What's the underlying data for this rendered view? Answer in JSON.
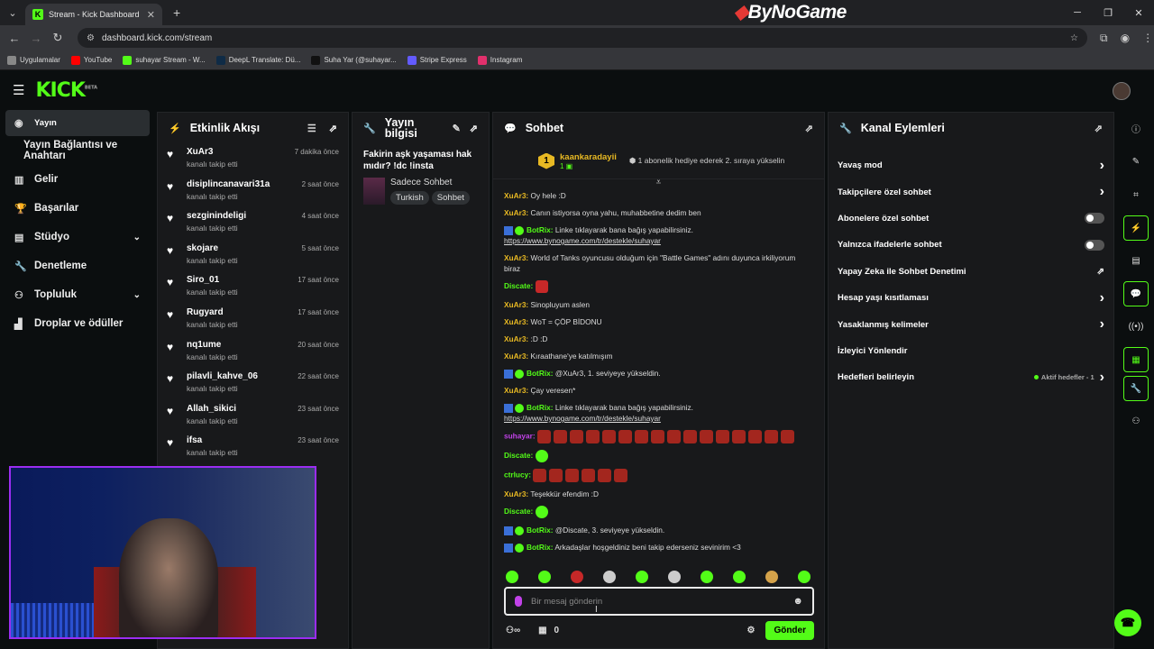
{
  "browser": {
    "tab_title": "Stream - Kick Dashboard",
    "url": "dashboard.kick.com/stream",
    "overlay_brand": "ByNoGame",
    "bookmarks": [
      {
        "label": "Uygulamalar",
        "color": "#888888"
      },
      {
        "label": "YouTube",
        "color": "#ff0000"
      },
      {
        "label": "suhayar Stream - W...",
        "color": "#53fc18"
      },
      {
        "label": "DeepL Translate: Dü...",
        "color": "#0f2b46"
      },
      {
        "label": "Suha Yar (@suhayar...",
        "color": "#111111"
      },
      {
        "label": "Stripe Express",
        "color": "#635bff"
      },
      {
        "label": "Instagram",
        "color": "#e1306c"
      }
    ]
  },
  "kick": {
    "logo": "KICK",
    "logo_sup": "BETA"
  },
  "sidebar": {
    "items": [
      {
        "label": "Yayın",
        "icon": "broadcast-icon"
      },
      {
        "label": "Yayın Bağlantısı ve Anahtarı",
        "icon": ""
      },
      {
        "label": "Gelir",
        "icon": "revenue-icon"
      },
      {
        "label": "Başarılar",
        "icon": "trophy-icon"
      },
      {
        "label": "Stüdyo",
        "icon": "studio-icon"
      },
      {
        "label": "Denetleme",
        "icon": "wrench-icon"
      },
      {
        "label": "Topluluk",
        "icon": "community-icon"
      },
      {
        "label": "Droplar ve ödüller",
        "icon": "drops-icon"
      }
    ]
  },
  "activity": {
    "title": "Etkinlik Akışı",
    "events": [
      {
        "name": "XuAr3",
        "sub": "kanalı takip etti",
        "time": "7 dakika önce"
      },
      {
        "name": "disiplincanavari31a",
        "sub": "kanalı takip etti",
        "time": "2 saat önce"
      },
      {
        "name": "sezginindeligi",
        "sub": "kanalı takip etti",
        "time": "4 saat önce"
      },
      {
        "name": "skojare",
        "sub": "kanalı takip etti",
        "time": "5 saat önce"
      },
      {
        "name": "Siro_01",
        "sub": "kanalı takip etti",
        "time": "17 saat önce"
      },
      {
        "name": "Rugyard",
        "sub": "kanalı takip etti",
        "time": "17 saat önce"
      },
      {
        "name": "nq1ume",
        "sub": "kanalı takip etti",
        "time": "20 saat önce"
      },
      {
        "name": "pilavli_kahve_06",
        "sub": "kanalı takip etti",
        "time": "22 saat önce"
      },
      {
        "name": "Allah_sikici",
        "sub": "kanalı takip etti",
        "time": "23 saat önce"
      },
      {
        "name": "ifsa",
        "sub": "kanalı takip etti",
        "time": "23 saat önce"
      }
    ]
  },
  "stream_info": {
    "title": "Yayın bilgisi",
    "stream_title": "Fakirin aşk yaşaması hak mıdır? !dc !insta",
    "category": "Sadece Sohbet",
    "tags": [
      "Turkish",
      "Sohbet"
    ]
  },
  "chat": {
    "title": "Sohbet",
    "pinned": {
      "rank": "1",
      "user": "kaankaradayii",
      "count": "1",
      "message": "1 abonelik hediye ederek 2. sıraya yükselin"
    },
    "messages": [
      {
        "user": "XuAr3:",
        "color": "#e8b923",
        "text": "Oy hele :D"
      },
      {
        "user": "XuAr3:",
        "color": "#e8b923",
        "text": "Canın istiyorsa oyna yahu, muhabbetine dedim ben"
      },
      {
        "user": "BotRix:",
        "color": "#53fc18",
        "bot": true,
        "text": "Linke tıklayarak bana bağış yapabilirsiniz.",
        "link": "https://www.bynogame.com/tr/destekle/suhayar"
      },
      {
        "user": "XuAr3:",
        "color": "#e8b923",
        "text": "World of Tanks oyuncusu olduğum için \"Battle Games\" adını duyunca irkiliyorum biraz"
      },
      {
        "user": "Discate:",
        "color": "#53fc18",
        "emote": "red"
      },
      {
        "user": "XuAr3:",
        "color": "#e8b923",
        "text": "Sinopluyum aslen"
      },
      {
        "user": "XuAr3:",
        "color": "#e8b923",
        "text": "WoT = ÇÖP BİDONU"
      },
      {
        "user": "XuAr3:",
        "color": "#e8b923",
        "text": ":D :D"
      },
      {
        "user": "XuAr3:",
        "color": "#e8b923",
        "text": "Kıraathane'ye katılmışım"
      },
      {
        "user": "BotRix:",
        "color": "#53fc18",
        "bot": true,
        "text": "@XuAr3, 1. seviyeye yükseldin."
      },
      {
        "user": "XuAr3:",
        "color": "#e8b923",
        "text": "Çay veresen*"
      },
      {
        "user": "BotRix:",
        "color": "#53fc18",
        "bot": true,
        "text": "Linke tıklayarak bana bağış yapabilirsiniz.",
        "link": "https://www.bynogame.com/tr/destekle/suhayar"
      },
      {
        "user": "suhayar:",
        "color": "#c142e8",
        "mugs": 16
      },
      {
        "user": "Discate:",
        "color": "#53fc18",
        "emote": "green"
      },
      {
        "user": "ctrlucy:",
        "color": "#53fc18",
        "mugs": 6
      },
      {
        "user": "XuAr3:",
        "color": "#e8b923",
        "text": "Teşekkür efendim :D"
      },
      {
        "user": "Discate:",
        "color": "#53fc18",
        "emote": "green"
      },
      {
        "user": "BotRix:",
        "color": "#53fc18",
        "bot": true,
        "text": "@Discate, 3. seviyeye yükseldin."
      },
      {
        "user": "BotRix:",
        "color": "#53fc18",
        "bot": true,
        "text": "Arkadaşlar hoşgeldiniz beni takip ederseniz sevinirim <3"
      }
    ],
    "placeholder": "Bir mesaj gönderin",
    "viewers": "0",
    "send_label": "Gönder"
  },
  "channel_actions": {
    "title": "Kanal Eylemleri",
    "items": [
      {
        "label": "Yavaş mod",
        "kind": "chevron"
      },
      {
        "label": "Takipçilere özel sohbet",
        "kind": "chevron"
      },
      {
        "label": "Abonelere özel sohbet",
        "kind": "toggle"
      },
      {
        "label": "Yalnızca ifadelerle sohbet",
        "kind": "toggle"
      },
      {
        "label": "Yapay Zeka ile Sohbet Denetimi",
        "kind": "external"
      },
      {
        "label": "Hesap yaşı kısıtlaması",
        "kind": "chevron"
      },
      {
        "label": "Yasaklanmış kelimeler",
        "kind": "chevron"
      },
      {
        "label": "İzleyici Yönlendir",
        "kind": "none"
      },
      {
        "label": "Hedefleri belirleyin",
        "kind": "chevron",
        "note": "Aktif hedefler - 1"
      }
    ]
  },
  "accent": "#53fc18"
}
